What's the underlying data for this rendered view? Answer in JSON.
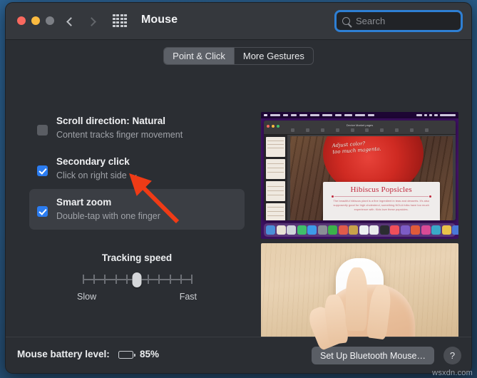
{
  "window": {
    "title": "Mouse",
    "traffic_lights": [
      "close",
      "minimize",
      "zoom"
    ],
    "nav_back": "‹",
    "nav_forward": "›",
    "grid_icon": "grid-icon"
  },
  "search": {
    "placeholder": "Search",
    "value": "",
    "icon": "search-icon",
    "focused": true,
    "focus_color": "#2e7fd4"
  },
  "tabs": [
    {
      "label": "Point & Click",
      "active": true
    },
    {
      "label": "More Gestures",
      "active": false
    }
  ],
  "options": [
    {
      "id": "scroll-direction",
      "title": "Scroll direction: Natural",
      "subtitle": "Content tracks finger movement",
      "checked": false,
      "selected": false,
      "has_popup": false
    },
    {
      "id": "secondary-click",
      "title": "Secondary click",
      "subtitle": "Click on right side",
      "checked": true,
      "selected": false,
      "has_popup": true
    },
    {
      "id": "smart-zoom",
      "title": "Smart zoom",
      "subtitle": "Double-tap with one finger",
      "checked": true,
      "selected": true,
      "has_popup": false
    }
  ],
  "tracking": {
    "label": "Tracking speed",
    "min_label": "Slow",
    "max_label": "Fast",
    "tick_count": 11,
    "value_percent": 50
  },
  "preview_top": {
    "name": "pages-document-screenshot",
    "doc_title": "Device Market pages",
    "handwriting_line1": "Adjust color?",
    "handwriting_line2": "too much magenta.",
    "card_heading": "Hibiscus Popsicles",
    "card_body": "The beautiful hibiscus plant is a fine ingredient in teas and desserts. It's also supposedly good for high cholesterol, something NOLA folks have too much experience with. Kids love these popsicles.",
    "menu_items": [
      "Pages",
      "File",
      "Edit",
      "Insert",
      "Format",
      "Arrange",
      "View",
      "Share",
      "Window",
      "Help"
    ],
    "dock_colors": [
      "#4b8fd8",
      "#e8e2d6",
      "#cfd4da",
      "#3fbf6a",
      "#3d9ae8",
      "#8a8f96",
      "#3bb24a",
      "#e05b4a",
      "#c9a24a",
      "#eceff2",
      "#e9eaec",
      "#2b2d31",
      "#ef4f5a",
      "#7d5cc6",
      "#e05a3a",
      "#d84a96",
      "#3aa8c8",
      "#e8c24a",
      "#4a78d8",
      "#8a8f96",
      "#4b8fd8",
      "#6d7178"
    ]
  },
  "preview_bottom": {
    "name": "magic-mouse-photo",
    "description": "Hand resting on white Magic Mouse on a wooden desk"
  },
  "annotation": {
    "type": "arrow",
    "color": "#ef3b16",
    "points_to": "smart-zoom-row"
  },
  "bottom": {
    "battery_label": "Mouse battery level:",
    "battery_percent": "85%",
    "battery_level": 85,
    "setup_button": "Set Up Bluetooth Mouse…",
    "help_button": "?"
  },
  "watermark": "wsxdn.com"
}
